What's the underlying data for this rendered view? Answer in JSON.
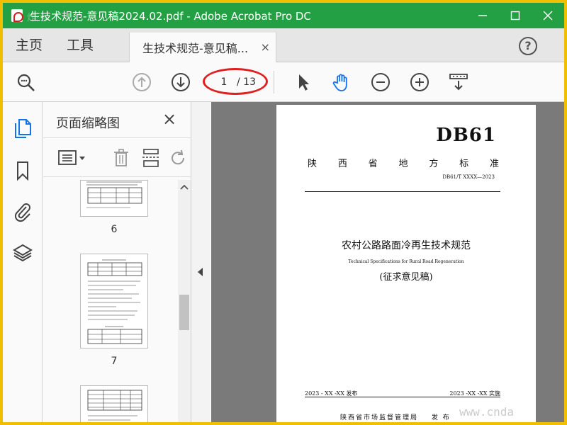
{
  "window": {
    "title": "生技术规范-意见稿2024.02.pdf - Adobe Acrobat Pro DC",
    "watermark_top": "炸·亏"
  },
  "tabs": {
    "home": "主页",
    "tools": "工具",
    "document_tab": "生技术规范-意见稿...",
    "close": "×",
    "help": "?"
  },
  "toolbar": {
    "current_page": "1",
    "page_total": "/ 13"
  },
  "thumbnails_panel": {
    "title": "页面缩略图",
    "close": "×",
    "pages": [
      {
        "label": "6"
      },
      {
        "label": "7"
      },
      {
        "label": ""
      }
    ]
  },
  "document": {
    "code": "DB61",
    "province_chars": [
      "陕",
      "西",
      "省",
      "地",
      "方",
      "标",
      "准"
    ],
    "standard_number": "DB61/T XXXX—2023",
    "title_cn": "农村公路路面冷再生技术规范",
    "title_en": "Technical Specifications for Rural Road Regeneration",
    "draft_note": "(征求意见稿)",
    "issue_date": "2023 - XX -XX 发布",
    "effective_date": "2023 -XX -XX 实施",
    "publisher": "陕西省市场监督管理局",
    "publish_word": "发 布",
    "watermark": "www.cnda"
  },
  "colors": {
    "titlebar": "#24a044",
    "accent_blue": "#1473e6",
    "annotation_red": "#e02020",
    "border_yellow": "#f0c000"
  }
}
